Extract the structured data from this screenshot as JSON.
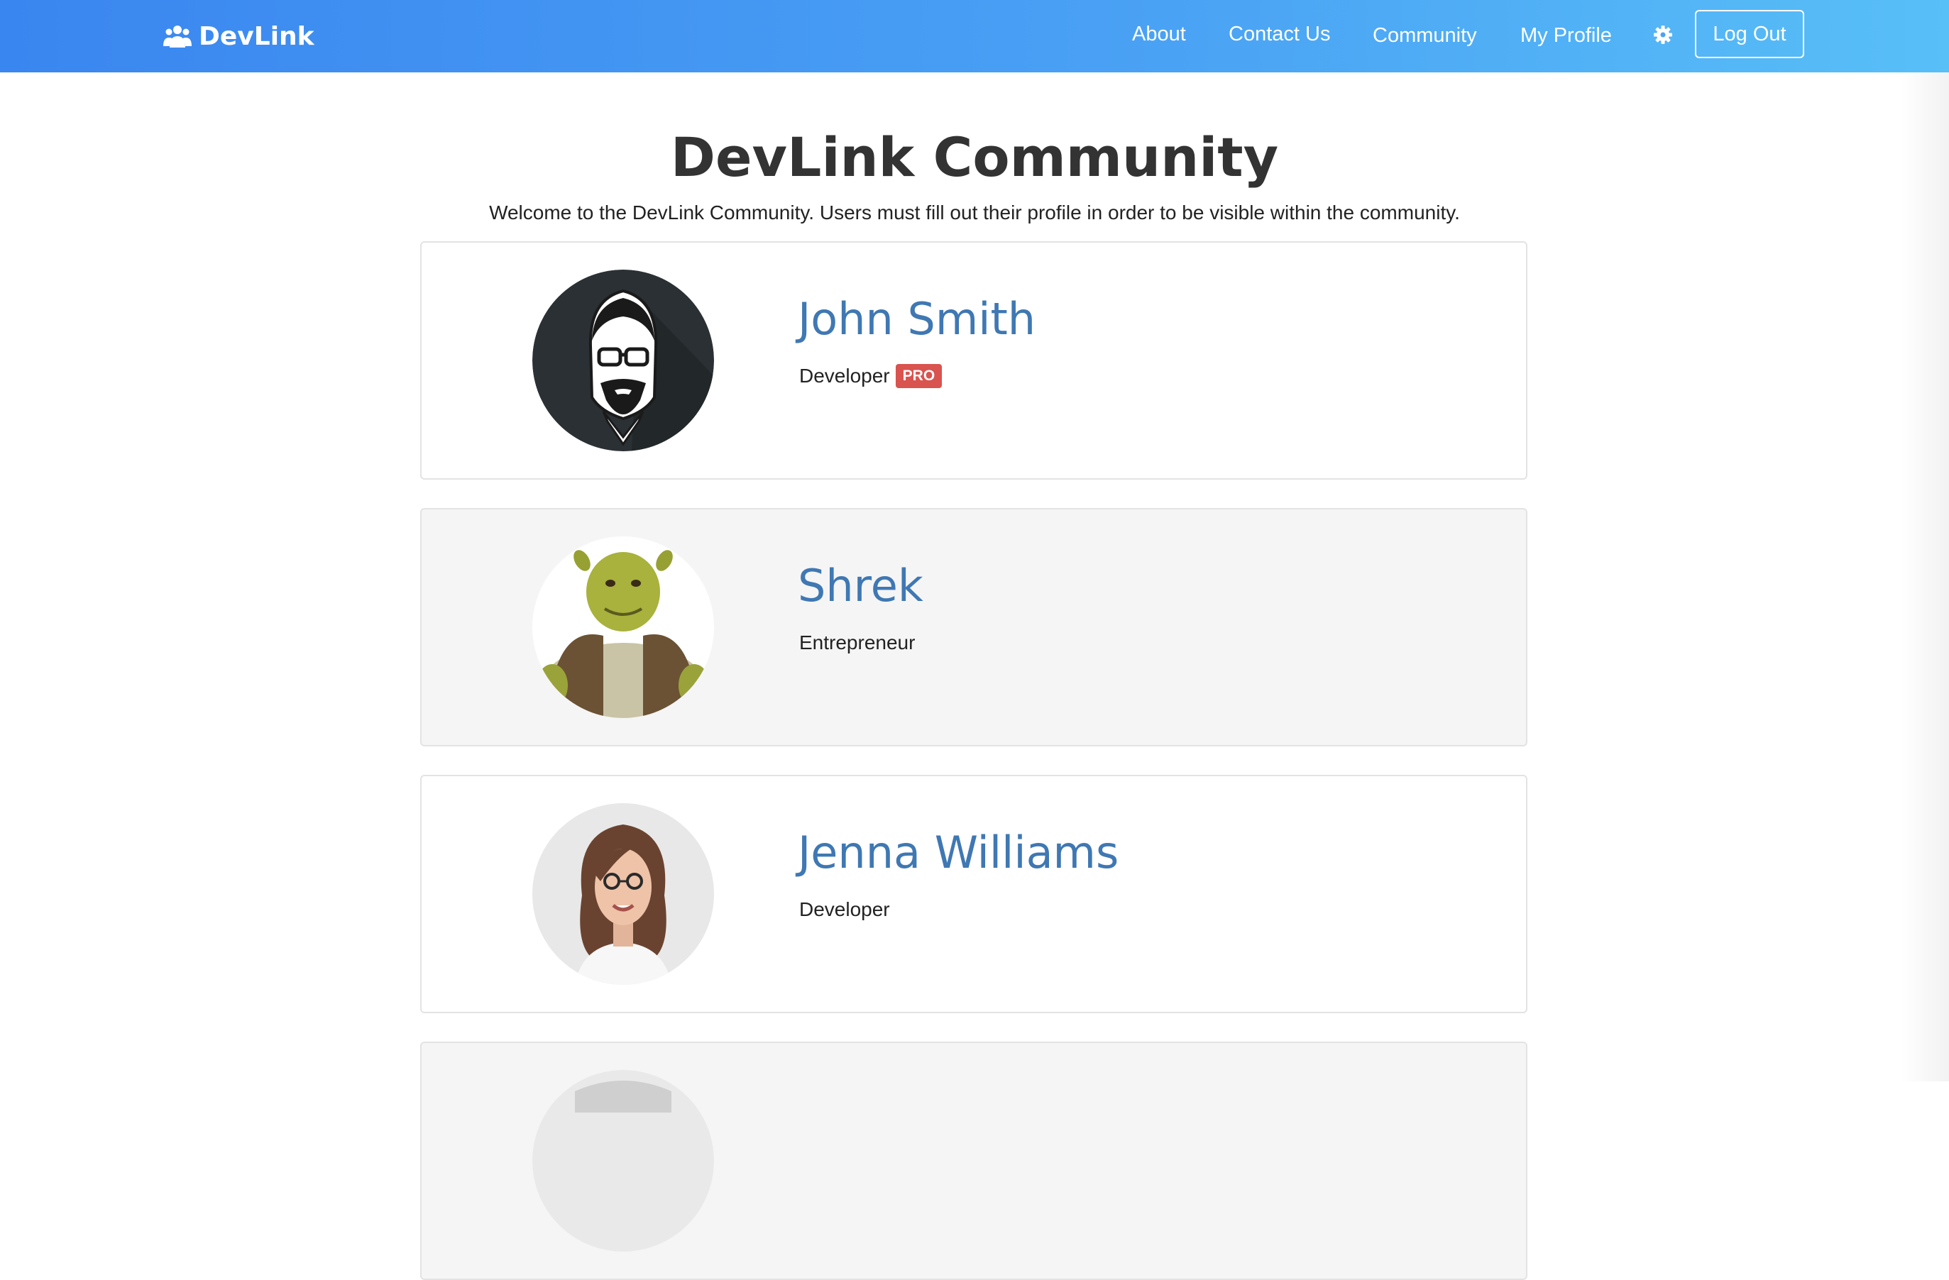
{
  "navbar": {
    "brand": "DevLink",
    "links": [
      "About",
      "Contact Us",
      "Community",
      "My Profile"
    ],
    "logout_label": "Log Out",
    "colors": {
      "gradient_start": "#3a86f0",
      "gradient_end": "#58bff7"
    }
  },
  "page": {
    "title": "DevLink Community",
    "subtitle": "Welcome to the DevLink Community. Users must fill out their profile in order to be visible within the community."
  },
  "profiles": [
    {
      "name": "John Smith",
      "role": "Developer",
      "badge": "PRO",
      "avatar": "illustrated-man-avatar"
    },
    {
      "name": "Shrek",
      "role": "Entrepreneur",
      "avatar": "ogre-avatar"
    },
    {
      "name": "Jenna Williams",
      "role": "Developer",
      "avatar": "woman-photo-avatar"
    }
  ],
  "colors": {
    "name_link": "#3f78b3",
    "pro_badge": "#d9534f",
    "card_alt_bg": "#f5f5f5"
  }
}
